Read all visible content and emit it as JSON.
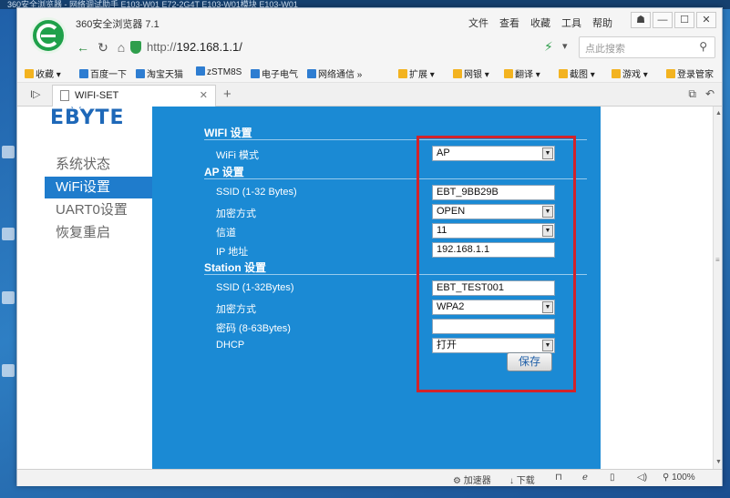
{
  "desktop": {
    "top_text": "360安全浏览器 - 网络调试助手          E103-W01   E72-2G4T   E103-W01模块          E103-W01"
  },
  "browser": {
    "title": "360安全浏览器 7.1",
    "menu": [
      "文件",
      "查看",
      "收藏",
      "工具",
      "帮助"
    ],
    "url_prefix": "http://",
    "url_host": "192.168.1.1/",
    "search_placeholder": "点此搜索",
    "favorites": [
      "收藏",
      "百度一下",
      "淘宝天猫",
      "zSTM8S",
      "电子电气",
      "网络通信",
      "扩展",
      "网银",
      "翻译",
      "截图",
      "游戏",
      "登录管家"
    ],
    "tab_title": "WIFI-SET",
    "status": {
      "accelerator": "加速器",
      "download": "下载",
      "zoom": "100%"
    }
  },
  "sidebar": {
    "brand": "EBYTE",
    "items": [
      {
        "label": "系统状态"
      },
      {
        "label": "WiFi设置"
      },
      {
        "label": "UART0设置"
      },
      {
        "label": "恢复重启"
      }
    ]
  },
  "form": {
    "wifi_section": "WIFI 设置",
    "wifi_mode_label": "WiFi 模式",
    "wifi_mode_value": "AP",
    "ap_section": "AP 设置",
    "ap_ssid_label": "SSID (1-32 Bytes)",
    "ap_ssid_value": "EBT_9BB29B",
    "ap_enc_label": "加密方式",
    "ap_enc_value": "OPEN",
    "ap_channel_label": "信道",
    "ap_channel_value": "11",
    "ap_ip_label": "IP 地址",
    "ap_ip_value": "192.168.1.1",
    "sta_section": "Station 设置",
    "sta_ssid_label": "SSID (1-32Bytes)",
    "sta_ssid_value": "EBT_TEST001",
    "sta_enc_label": "加密方式",
    "sta_enc_value": "WPA2",
    "sta_pwd_label": "密码 (8-63Bytes)",
    "sta_pwd_value": "",
    "sta_dhcp_label": "DHCP",
    "sta_dhcp_value": "打开",
    "save_label": "保存"
  },
  "colors": {
    "main_panel": "#1b8ad4",
    "sidebar_active": "#1f7ccc",
    "highlight_box": "#d2232a",
    "brand": "#1e68b8"
  }
}
